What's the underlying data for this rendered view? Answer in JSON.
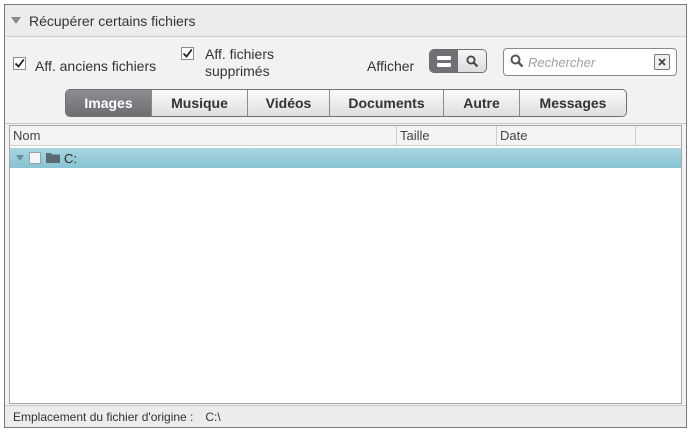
{
  "panel": {
    "title": "Récupérer certains fichiers"
  },
  "toolbar": {
    "show_old_files": {
      "label": "Aff. anciens fichiers",
      "checked": true
    },
    "show_deleted_files": {
      "label_line1": "Aff. fichiers",
      "label_line2": "supprimés",
      "checked": true
    },
    "display_label": "Afficher",
    "search_placeholder": "Rechercher"
  },
  "tabs": [
    {
      "label": "Images",
      "active": true
    },
    {
      "label": "Musique",
      "active": false
    },
    {
      "label": "Vidéos",
      "active": false
    },
    {
      "label": "Documents",
      "active": false
    },
    {
      "label": "Autre",
      "active": false
    },
    {
      "label": "Messages",
      "active": false
    }
  ],
  "columns": {
    "name": "Nom",
    "size": "Taille",
    "date": "Date"
  },
  "rows": [
    {
      "name": "C:"
    }
  ],
  "status": {
    "label": "Emplacement du fichier d'origine :",
    "path": "C:\\"
  },
  "colors": {
    "row_selected": "#98cbd9",
    "tab_active": "#7c7d80"
  },
  "icons": {
    "search": "magnifier-icon",
    "clear": "close-x-icon",
    "folder": "folder-icon",
    "expand": "triangle-down-icon"
  }
}
